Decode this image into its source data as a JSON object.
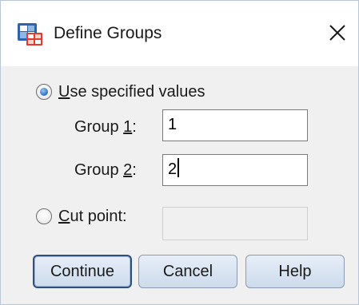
{
  "window": {
    "title": "Define Groups",
    "icon": "spss-dialog-icon",
    "close_icon": "close-icon"
  },
  "use_specified": {
    "label_mnemonic": "U",
    "label_rest": "se specified values",
    "selected": true
  },
  "group1": {
    "label_pre": "Group ",
    "label_mnemonic": "1",
    "label_post": ":",
    "value": "1"
  },
  "group2": {
    "label_pre": "Group ",
    "label_mnemonic": "2",
    "label_post": ":",
    "value": "2"
  },
  "cut_point": {
    "label_mnemonic": "C",
    "label_rest": "ut point:",
    "selected": false,
    "value": ""
  },
  "buttons": {
    "continue": "Continue",
    "cancel": "Cancel",
    "help": "Help"
  },
  "colors": {
    "accent": "#2a6fc0",
    "button_bg": "#d5e1ef",
    "dialog_bg": "#f0f0f0"
  }
}
